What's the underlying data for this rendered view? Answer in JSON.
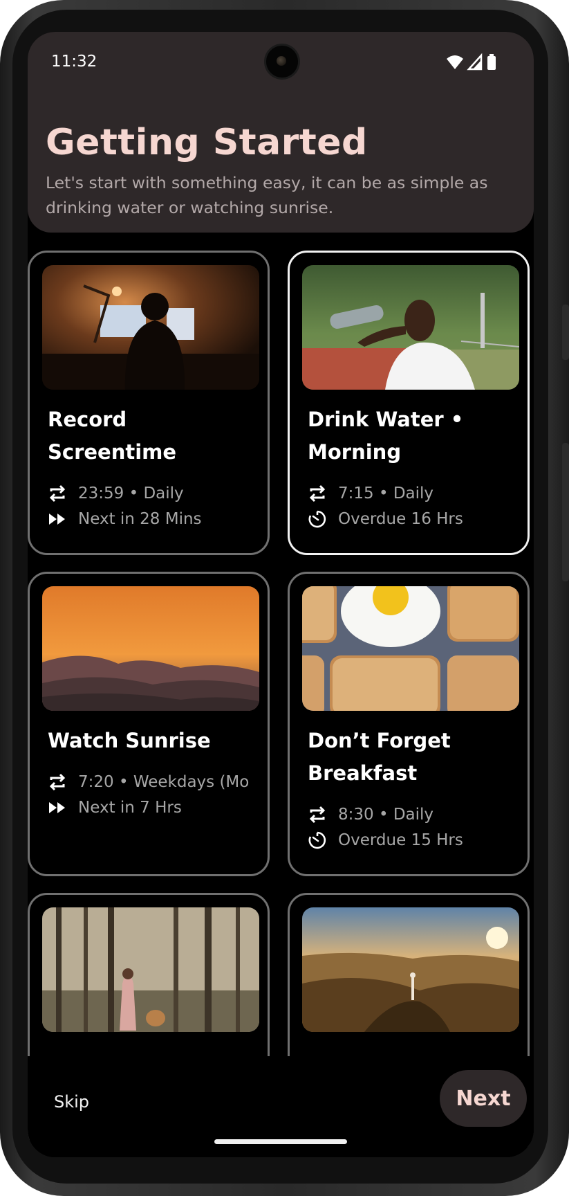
{
  "status_bar": {
    "time": "11:32",
    "icons": [
      "wifi-icon",
      "signal-icon",
      "battery-icon"
    ]
  },
  "header": {
    "title": "Getting Started",
    "subtitle": "Let's start with something easy, it can be as simple as drinking water or watching sunrise."
  },
  "cards": [
    {
      "title": "Record Screentime",
      "image": "person at desk with monitors at night",
      "schedule": "23:59 • Daily",
      "status": "Next in 28 Mins",
      "status_icon": "fast-forward-icon",
      "selected": false
    },
    {
      "title": "Drink Water • Morning",
      "image": "man drinking from water bottle",
      "schedule": "7:15 • Daily",
      "status": "Overdue 16 Hrs",
      "status_icon": "timer-icon",
      "selected": true
    },
    {
      "title": "Watch Sunrise",
      "image": "orange sunrise over mountains",
      "schedule": "7:20 • Weekdays (Mo",
      "status": "Next in 7 Hrs",
      "status_icon": "fast-forward-icon",
      "selected": false
    },
    {
      "title": "Don’t Forget Breakfast",
      "image": "fried egg on toast slices",
      "schedule": "8:30 • Daily",
      "status": "Overdue 15 Hrs",
      "status_icon": "timer-icon",
      "selected": false
    },
    {
      "title": "",
      "image": "person walking a dog in forest",
      "selected": false
    },
    {
      "title": "",
      "image": "person doing yoga on mountain at sunset",
      "selected": false
    }
  ],
  "footer": {
    "skip_label": "Skip",
    "next_label": "Next"
  },
  "colors": {
    "header_bg": "#2e2829",
    "title": "#f6d7d1",
    "card_border": "#707070",
    "card_border_selected": "#f2f2f2",
    "background": "#000000"
  }
}
